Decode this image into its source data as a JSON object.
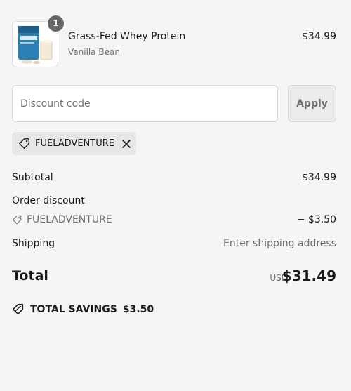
{
  "product": {
    "name": "Grass-Fed Whey Protein",
    "variant": "Vanilla Bean",
    "price": "$34.99",
    "quantity": "1",
    "image_icon": "protein-bag-image"
  },
  "discount": {
    "placeholder": "Discount code",
    "apply_label": "Apply",
    "applied_code": "FUELADVENTURE"
  },
  "summary": {
    "subtotal_label": "Subtotal",
    "subtotal_value": "$34.99",
    "order_discount_label": "Order discount",
    "order_discount_code": "FUELADVENTURE",
    "order_discount_value": "− $3.50",
    "shipping_label": "Shipping",
    "shipping_value": "Enter shipping address",
    "total_label": "Total",
    "currency": "USD",
    "total_value": "$31.49",
    "savings_label": "TOTAL SAVINGS",
    "savings_value": "$3.50"
  },
  "colors": {
    "background": "#f5f5f5",
    "muted_text": "#707070",
    "tag_background": "#e6e6e6"
  }
}
